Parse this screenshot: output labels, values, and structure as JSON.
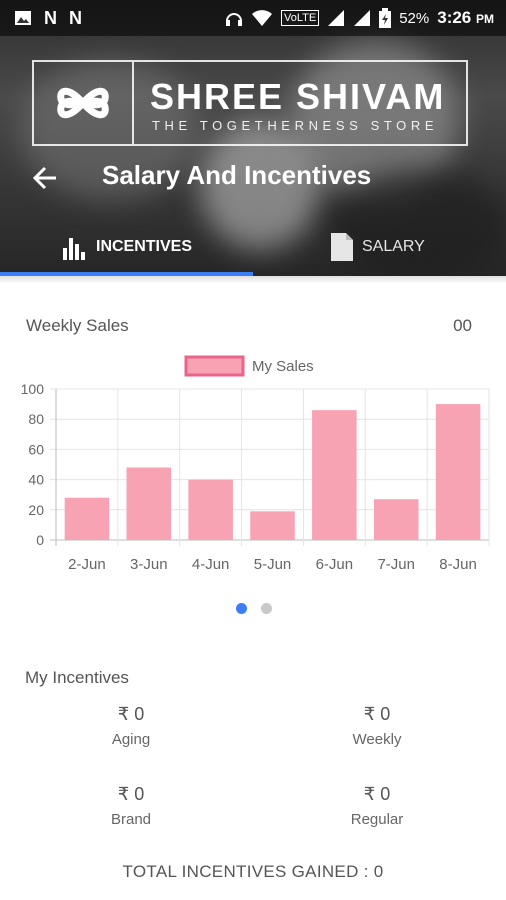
{
  "status_bar": {
    "left_icons": [
      "image-icon",
      "n-icon",
      "n-icon"
    ],
    "right_icons": [
      "headphones-icon",
      "wifi-icon",
      "volte-icon",
      "signal-icon",
      "signal-icon",
      "battery-icon"
    ],
    "volte_label": "VoLTE",
    "battery": "52%",
    "time": "3:26",
    "ampm": "PM"
  },
  "header": {
    "brand_name": "SHREE SHIVAM",
    "brand_tagline": "THE TOGETHERNESS STORE",
    "title": "Salary And Incentives"
  },
  "tabs": [
    {
      "label": "INCENTIVES",
      "icon": "bar-chart-icon",
      "active": true
    },
    {
      "label": "SALARY",
      "icon": "document-icon",
      "active": false
    }
  ],
  "weekly_sales": {
    "title": "Weekly Sales",
    "value": "00"
  },
  "chart_data": {
    "type": "bar",
    "categories": [
      "2-Jun",
      "3-Jun",
      "4-Jun",
      "5-Jun",
      "6-Jun",
      "7-Jun",
      "8-Jun"
    ],
    "series": [
      {
        "name": "My Sales",
        "values": [
          28,
          48,
          40,
          19,
          86,
          27,
          90
        ]
      }
    ],
    "ylim": [
      0,
      100
    ],
    "yticks": [
      0,
      20,
      40,
      60,
      80,
      100
    ],
    "grid": true,
    "legend": "top-center",
    "colors": {
      "fill": "#f8a3b4",
      "stroke": "#e8648a"
    }
  },
  "pager": {
    "pages": 2,
    "active": 0
  },
  "incentives": {
    "title": "My Incentives",
    "items": [
      {
        "value": "₹ 0",
        "label": "Aging"
      },
      {
        "value": "₹ 0",
        "label": "Weekly"
      },
      {
        "value": "₹ 0",
        "label": "Brand"
      },
      {
        "value": "₹ 0",
        "label": "Regular"
      }
    ],
    "total_text": "TOTAL INCENTIVES GAINED : 0"
  },
  "colors": {
    "accent": "#3d7df5",
    "header_bg": "#3a3a3a"
  }
}
